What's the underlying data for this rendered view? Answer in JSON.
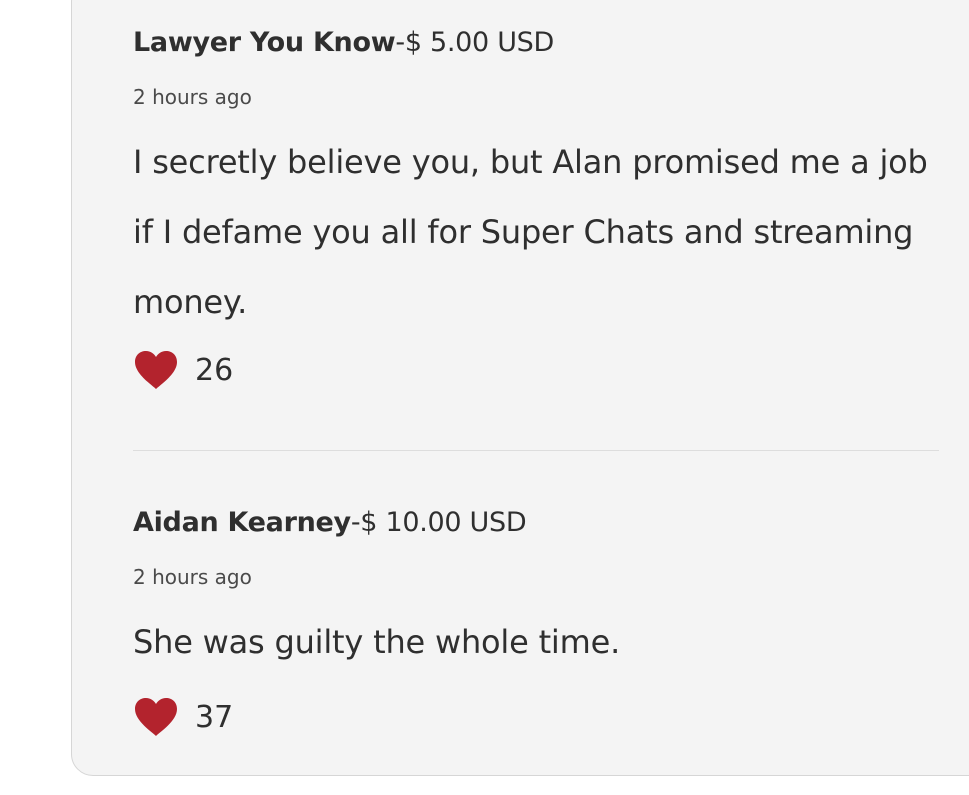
{
  "chats": [
    {
      "author": "Lawyer You Know",
      "amount": "-$ 5.00 USD",
      "time": "2 hours ago",
      "message": "I secretly believe you, but Alan promised me a job if I defame you all for Super Chats and streaming money.",
      "likes": "26"
    },
    {
      "author": "Aidan Kearney",
      "amount": "-$ 10.00 USD",
      "time": "2 hours ago",
      "message": "She was guilty the whole time.",
      "likes": "37"
    }
  ],
  "colors": {
    "heart": "#b3232d",
    "card_background": "#f4f4f4"
  },
  "icons": {
    "like": "heart-icon"
  }
}
